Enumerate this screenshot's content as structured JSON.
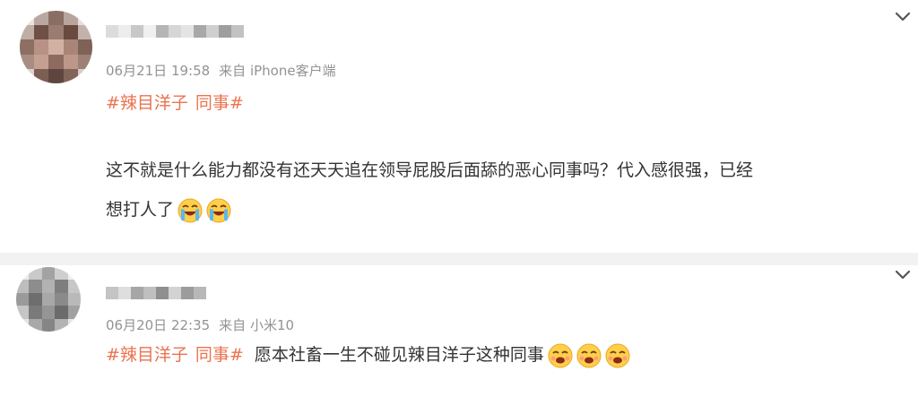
{
  "posts": [
    {
      "timestamp": "06月21日 19:58",
      "source": "来自 iPhone客户端",
      "tags": [
        "#辣目洋子",
        "同事#"
      ],
      "text": "这不就是什么能力都没有还天天追在领导屁股后面舔的恶心同事吗？代入感很强，已经",
      "text_line2": "想打人了",
      "emojis": [
        "crying-laughing-icon",
        "crying-laughing-icon"
      ]
    },
    {
      "timestamp": "06月20日 22:35",
      "source": "来自 小米10",
      "tags": [
        "#辣目洋子",
        "同事#"
      ],
      "text": "愿本社畜一生不碰见辣目洋子这种同事",
      "emojis": [
        "laughing-icon",
        "laughing-icon",
        "laughing-icon"
      ]
    }
  ],
  "colors": {
    "tag": "#eb7350",
    "meta": "#939393",
    "text": "#333333",
    "divider": "#f2f2f2"
  }
}
